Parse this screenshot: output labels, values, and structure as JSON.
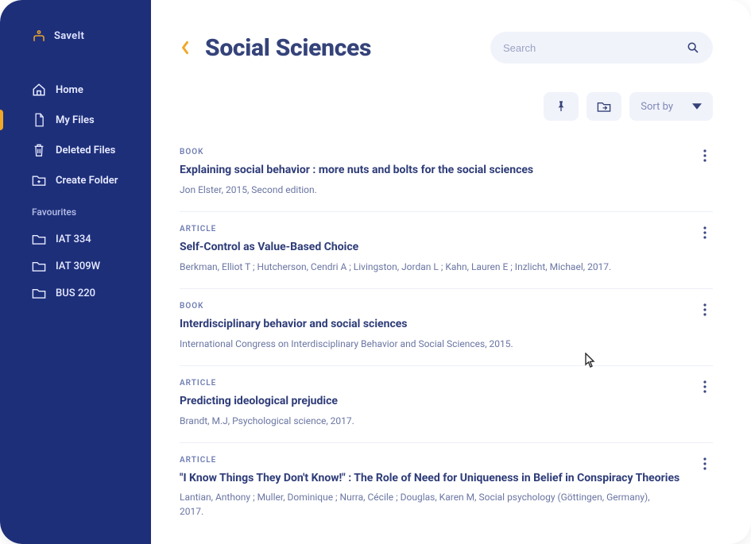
{
  "brand": "SaveIt",
  "sidebar": {
    "nav": [
      {
        "label": "Home"
      },
      {
        "label": "My Files",
        "active": true
      },
      {
        "label": "Deleted Files"
      },
      {
        "label": "Create Folder"
      }
    ],
    "favourites_heading": "Favourites",
    "favourites": [
      {
        "label": "IAT 334"
      },
      {
        "label": "IAT 309W"
      },
      {
        "label": "BUS 220"
      }
    ]
  },
  "header": {
    "title": "Social Sciences"
  },
  "search": {
    "placeholder": "Search",
    "value": ""
  },
  "toolbar": {
    "sort_label": "Sort by"
  },
  "entries": [
    {
      "type": "BOOK",
      "title": "Explaining social behavior : more nuts and bolts for the social sciences",
      "meta": "Jon Elster, 2015, Second edition."
    },
    {
      "type": "ARTICLE",
      "title": "Self-Control as Value-Based Choice",
      "meta": "Berkman, Elliot T ; Hutcherson, Cendri A ; Livingston, Jordan L ; Kahn, Lauren E ; Inzlicht, Michael, 2017."
    },
    {
      "type": "BOOK",
      "title": "Interdisciplinary behavior and social sciences",
      "meta": "International Congress on Interdisciplinary Behavior and Social Sciences, 2015."
    },
    {
      "type": "ARTICLE",
      "title": "Predicting ideological prejudice",
      "meta": "Brandt, M.J, Psychological science, 2017."
    },
    {
      "type": "ARTICLE",
      "title": "\"I Know Things They Don't Know!\" : The Role of Need for Uniqueness in Belief in Conspiracy Theories",
      "meta": "Lantian, Anthony ; Muller, Dominique ; Nurra, Cécile ; Douglas, Karen M, Social psychology (Göttingen, Germany), 2017."
    }
  ]
}
